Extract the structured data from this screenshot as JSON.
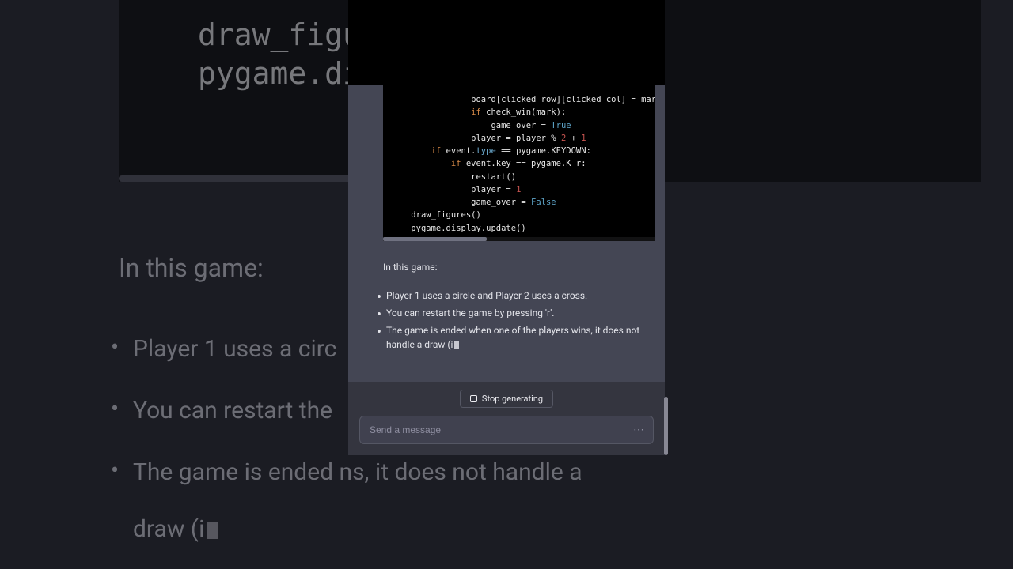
{
  "background": {
    "code_lines": [
      "draw_figure",
      "pygame.disp"
    ],
    "heading": "In this game:",
    "bullets": [
      "Player 1 uses a circ",
      "You can restart the",
      "The game is ended",
      "draw (i"
    ]
  },
  "foreground": {
    "code": {
      "lines": [
        {
          "indent": 16,
          "parts": [
            {
              "t": "board[clicked_row][clicked_col] = mark",
              "c": ""
            }
          ]
        },
        {
          "indent": 16,
          "parts": [
            {
              "t": "if ",
              "c": "kw"
            },
            {
              "t": "check_win(mark):",
              "c": ""
            }
          ]
        },
        {
          "indent": 20,
          "parts": [
            {
              "t": "game_over = ",
              "c": ""
            },
            {
              "t": "True",
              "c": "const"
            }
          ]
        },
        {
          "indent": 16,
          "parts": [
            {
              "t": "player = player % ",
              "c": ""
            },
            {
              "t": "2",
              "c": "num"
            },
            {
              "t": " + ",
              "c": ""
            },
            {
              "t": "1",
              "c": "num"
            }
          ]
        },
        {
          "indent": 8,
          "parts": [
            {
              "t": "if ",
              "c": "kw"
            },
            {
              "t": "event.",
              "c": ""
            },
            {
              "t": "type",
              "c": "attr"
            },
            {
              "t": " == pygame.KEYDOWN:",
              "c": ""
            }
          ]
        },
        {
          "indent": 12,
          "parts": [
            {
              "t": "if ",
              "c": "kw"
            },
            {
              "t": "event.key == pygame.K_r:",
              "c": ""
            }
          ]
        },
        {
          "indent": 16,
          "parts": [
            {
              "t": "restart()",
              "c": ""
            }
          ]
        },
        {
          "indent": 16,
          "parts": [
            {
              "t": "player = ",
              "c": ""
            },
            {
              "t": "1",
              "c": "num"
            }
          ]
        },
        {
          "indent": 16,
          "parts": [
            {
              "t": "game_over = ",
              "c": ""
            },
            {
              "t": "False",
              "c": "const"
            }
          ]
        },
        {
          "indent": 0,
          "parts": [
            {
              "t": "",
              "c": ""
            }
          ]
        },
        {
          "indent": 4,
          "parts": [
            {
              "t": "draw_figures()",
              "c": ""
            }
          ]
        },
        {
          "indent": 4,
          "parts": [
            {
              "t": "pygame.display.update()",
              "c": ""
            }
          ]
        }
      ]
    },
    "explanation": {
      "heading": "In this game:",
      "bullets": [
        "Player 1 uses a circle and Player 2 uses a cross.",
        "You can restart the game by pressing 'r'.",
        "The game is ended when one of the players wins, it does not handle a draw (i"
      ]
    },
    "stop_label": "Stop generating",
    "input_placeholder": "Send a message"
  }
}
